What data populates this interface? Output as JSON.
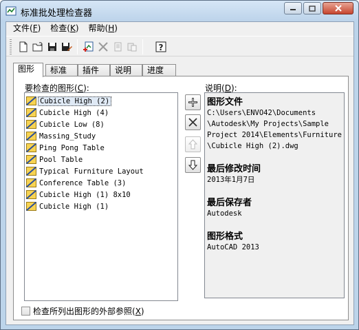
{
  "window": {
    "title": "标准批处理检查器"
  },
  "menu": [
    {
      "label": "文件(",
      "key": "F",
      "tail": ")"
    },
    {
      "label": "检查(",
      "key": "K",
      "tail": ")"
    },
    {
      "label": "帮助(",
      "key": "H",
      "tail": ")"
    }
  ],
  "toolbar": {
    "items": [
      "new-file-icon",
      "open-folder-icon",
      "save-icon",
      "save-as-icon",
      "add-drawing-icon",
      "remove-icon",
      "copy-icon",
      "paste-icon",
      "help-icon"
    ]
  },
  "tabs": [
    "图形",
    "标准",
    "插件",
    "说明",
    "进度"
  ],
  "left": {
    "label": "要检查的图形(",
    "label_key": "C",
    "label_tail": "):",
    "items": [
      "Cubicle High (2)",
      "Cubicle High (4)",
      "Cubicle Low (8)",
      "Massing_Study",
      "Ping Pong Table",
      "Pool Table",
      "Typical Furniture Layout",
      "Conference Table (3)",
      "Cubicle High (1) 8x10",
      "Cubicle High (1)"
    ]
  },
  "right": {
    "label": "说明(",
    "label_key": "D",
    "label_tail": "):",
    "file_heading": "图形文件",
    "file_path_lines": [
      "C:\\Users\\ENVO42\\Documents",
      "\\Autodesk\\My Projects\\Sample",
      "Project 2014\\Elements\\Furniture",
      "\\Cubicle High (2).dwg"
    ],
    "modified_heading": "最后修改时间",
    "modified_value": "2013年1月7日",
    "saved_by_heading": "最后保存者",
    "saved_by_value": "Autodesk",
    "format_heading": "图形格式",
    "format_value": "AutoCAD 2013"
  },
  "checkbox": {
    "label": "检查所列出图形的外部参照(",
    "key": "X",
    "tail": ")"
  },
  "colors": {
    "accent": "#bcd4ea",
    "selection": "#dfe9f5",
    "close": "#c7452f"
  }
}
